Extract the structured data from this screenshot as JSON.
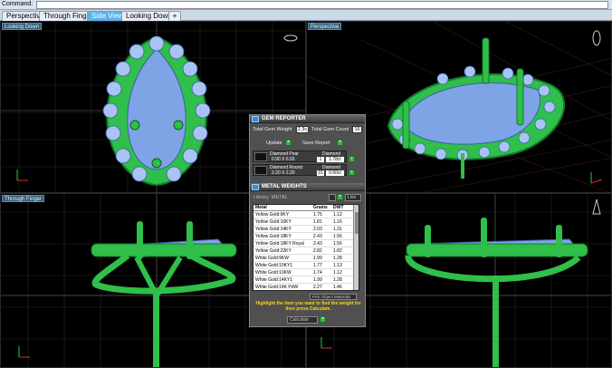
{
  "command": {
    "label": "Command:"
  },
  "tabs": [
    {
      "label": "Perspective"
    },
    {
      "label": "Through Finger"
    },
    {
      "label": "Side View"
    },
    {
      "label": "Looking Down"
    },
    {
      "label": "+"
    }
  ],
  "viewports": {
    "top_left": {
      "label": "Looking Down"
    },
    "top_right": {
      "label": "Perspective"
    },
    "bottom_left": {
      "label": "Through Finger"
    }
  },
  "gem_reporter": {
    "title": "GEM REPORTER",
    "total_weight_label": "Total Gem Weight",
    "total_weight_value": "2.3c",
    "total_count_label": "Total Gem Count",
    "total_count_value": "16",
    "update_label": "Update",
    "save_label": "Save Report",
    "gems": [
      {
        "name": "Diamond Pear",
        "size": "0.90 X 6.93",
        "type": "Diamond",
        "count": "1",
        "weight": "1.78ct"
      },
      {
        "name": "Diamond Round",
        "size": "2.20 X 2.20",
        "type": "Diamond",
        "count": "15",
        "weight": "0.60ct"
      }
    ]
  },
  "metal_weights": {
    "title": "METAL WEIGHTS",
    "library_label": "Library: METAL",
    "unit": "Live",
    "headers": {
      "metal": "Metal",
      "grams": "Grams",
      "dwt": "DWT"
    },
    "rows": [
      {
        "metal": "Yellow Gold:9KY",
        "grams": "1.75",
        "dwt": "1.12"
      },
      {
        "metal": "Yellow Gold:10KY",
        "grams": "1.81",
        "dwt": "1.16"
      },
      {
        "metal": "Yellow Gold:14KY",
        "grams": "2.03",
        "dwt": "1.31"
      },
      {
        "metal": "Yellow Gold:18KY",
        "grams": "2.43",
        "dwt": "1.56"
      },
      {
        "metal": "Yellow Gold:18KY Royal",
        "grams": "2.43",
        "dwt": "1.56"
      },
      {
        "metal": "Yellow Gold:22KY",
        "grams": "2.82",
        "dwt": "1.82"
      },
      {
        "metal": "White Gold:9KW",
        "grams": "1.99",
        "dwt": "1.28"
      },
      {
        "metal": "White Gold:10KY1",
        "grams": "1.77",
        "dwt": "1.13"
      },
      {
        "metal": "White Gold:10KW",
        "grams": "1.74",
        "dwt": "1.12"
      },
      {
        "metal": "White Gold:14KY1",
        "grams": "1.99",
        "dwt": "1.28"
      },
      {
        "metal": "White Gold:14K PdW",
        "grams": "2.27",
        "dwt": "1.46"
      }
    ],
    "object_select": "Pick Object Materials",
    "hint": "Highlight the item you want to find the weight for then press Calculate.",
    "calculate_label": "Calculate"
  },
  "colors": {
    "metal_green": "#2fbf4a",
    "gem_blue": "#7fa4e6",
    "tab_active": "#5db0e8",
    "hint_yellow": "#ffd21a"
  }
}
